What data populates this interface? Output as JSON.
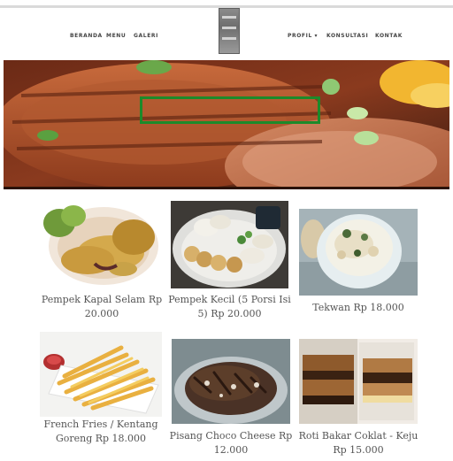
{
  "nav": {
    "left_links": [
      "BERANDA",
      "MENU",
      "GALERI"
    ],
    "right_links": [
      "PROFIL ▾",
      "KONSULTASI",
      "KONTAK"
    ]
  },
  "hero": {
    "image": "grilled-steak-banner"
  },
  "menu_items": [
    {
      "image": "pempek-kapal-selam-photo",
      "caption": "Pempek Kapal Selam Rp 20.000"
    },
    {
      "image": "pempek-kecil-photo",
      "caption": "Pempek Kecil (5 Porsi Isi 5) Rp 20.000"
    },
    {
      "image": "tekwan-photo",
      "caption": "Tekwan Rp 18.000"
    },
    {
      "image": "french-fries-photo",
      "caption": "French Fries / Kentang Goreng Rp 18.000"
    },
    {
      "image": "pisang-choco-cheese-photo",
      "caption": "Pisang Choco Cheese Rp 12.000"
    },
    {
      "image": "roti-bakar-photo",
      "caption": "Roti Bakar Coklat - Keju Rp 15.000"
    }
  ],
  "colors": {
    "highlight_box": "#1c8a2a",
    "nav_text": "#444444",
    "caption_text": "#555555"
  }
}
